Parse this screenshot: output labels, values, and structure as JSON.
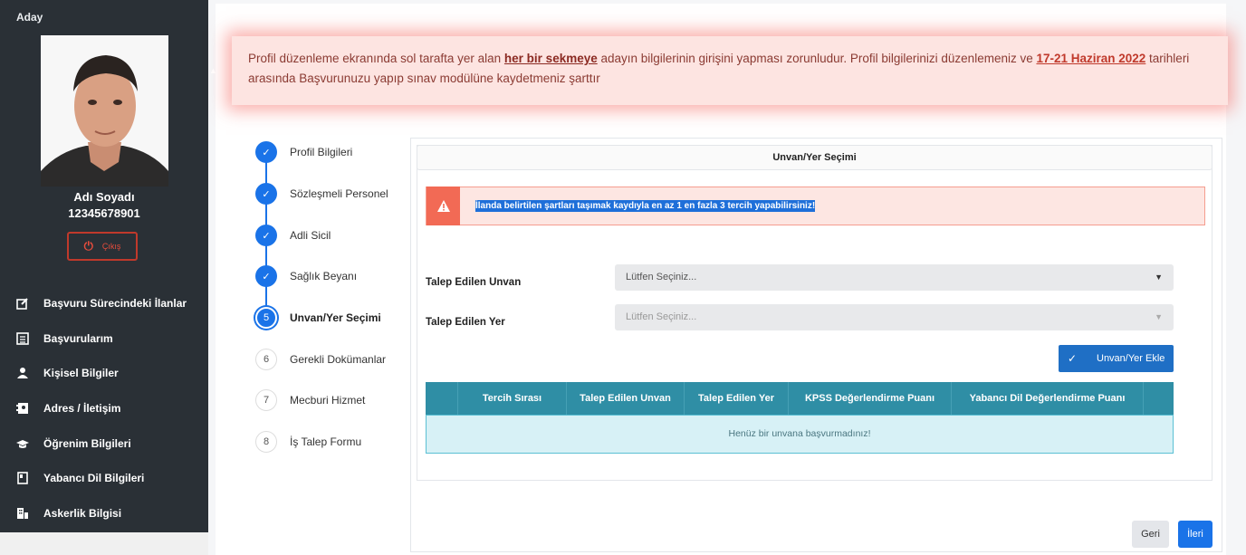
{
  "sidebar": {
    "role": "Aday",
    "user_name": "Adı Soyadı",
    "user_id": "12345678901",
    "logout_label": "Çıkış",
    "items": [
      {
        "label": "Başvuru Sürecindeki İlanlar",
        "icon": "edit-icon"
      },
      {
        "label": "Başvurularım",
        "icon": "list-icon"
      },
      {
        "label": "Kişisel Bilgiler",
        "icon": "user-icon"
      },
      {
        "label": "Adres / İletişim",
        "icon": "address-book-icon"
      },
      {
        "label": "Öğrenim Bilgileri",
        "icon": "graduation-cap-icon"
      },
      {
        "label": "Yabancı Dil Bilgileri",
        "icon": "book-icon"
      },
      {
        "label": "Askerlik Bilgisi",
        "icon": "building-icon"
      }
    ]
  },
  "notice": {
    "text_1": "Profil düzenleme ekranında sol tarafta yer alan ",
    "link_1": "her bir sekmeye",
    "text_2": " adayın bilgilerinin girişini yapması zorunludur.  Profil bilgilerinizi düzenlemeniz ve ",
    "date": "17-21 Haziran 2022",
    "text_3": " tarihleri arasında Başvurunuzu yapıp sınav modülüne kaydetmeniz şarttır"
  },
  "steps": [
    {
      "num": "1",
      "label": "Profil Bilgileri",
      "state": "done"
    },
    {
      "num": "2",
      "label": "Sözleşmeli Personel",
      "state": "done"
    },
    {
      "num": "3",
      "label": "Adli Sicil",
      "state": "done"
    },
    {
      "num": "4",
      "label": "Sağlık Beyanı",
      "state": "done"
    },
    {
      "num": "5",
      "label": "Unvan/Yer Seçimi",
      "state": "active"
    },
    {
      "num": "6",
      "label": "Gerekli Dokümanlar",
      "state": "todo"
    },
    {
      "num": "7",
      "label": "Mecburi Hizmet",
      "state": "todo"
    },
    {
      "num": "8",
      "label": "İş Talep Formu",
      "state": "todo"
    }
  ],
  "main": {
    "section_title": "Unvan/Yer Seçimi",
    "warning": "İlanda belirtilen şartları taşımak kaydıyla en az 1 en fazla 3 tercih yapabilirsiniz!",
    "unvan_label": "Talep Edilen Unvan",
    "unvan_value": "Lütfen Seçiniz...",
    "yer_label": "Talep Edilen Yer",
    "yer_value": "Lütfen Seçiniz...",
    "add_button": "Unvan/Yer Ekle",
    "table_headers": [
      "",
      "Tercih Sırası",
      "Talep Edilen Unvan",
      "Talep Edilen Yer",
      "KPSS Değerlendirme Puanı",
      "Yabancı Dil Değerlendirme Puanı",
      ""
    ],
    "empty_message": "Henüz bir unvana başvurmadınız!",
    "back_button": "Geri",
    "next_button": "İleri"
  },
  "colors": {
    "sidebar_bg": "#2a3036",
    "primary": "#1a73e8",
    "table_head": "#2f8ea5",
    "notice_bg": "#fde4e1",
    "warning_icon": "#f26a55"
  }
}
